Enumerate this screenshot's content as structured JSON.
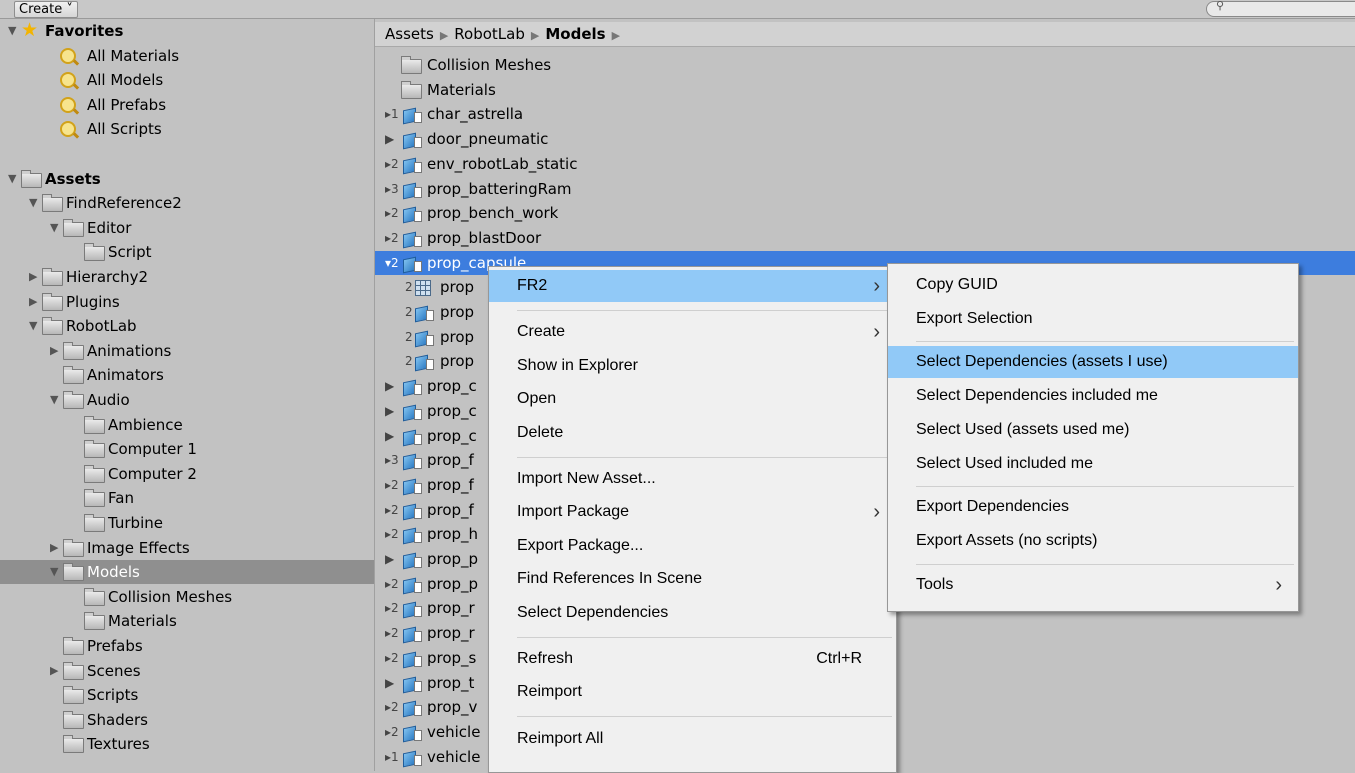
{
  "toolbar": {
    "create_label": "Create ˅",
    "search_placeholder": ""
  },
  "tree": [
    {
      "label": "Favorites",
      "indent": 0,
      "icon": "star",
      "tri": "▼",
      "bold": true
    },
    {
      "label": "All Materials",
      "indent": 2,
      "icon": "search"
    },
    {
      "label": "All Models",
      "indent": 2,
      "icon": "search"
    },
    {
      "label": "All Prefabs",
      "indent": 2,
      "icon": "search"
    },
    {
      "label": "All Scripts",
      "indent": 2,
      "icon": "search"
    },
    {
      "label": "",
      "indent": 0,
      "icon": "none"
    },
    {
      "label": "Assets",
      "indent": 0,
      "icon": "folder",
      "tri": "▼",
      "bold": true
    },
    {
      "label": "FindReference2",
      "indent": 1,
      "icon": "folder",
      "tri": "▼"
    },
    {
      "label": "Editor",
      "indent": 2,
      "icon": "folder",
      "tri": "▼"
    },
    {
      "label": "Script",
      "indent": 3,
      "icon": "folder"
    },
    {
      "label": "Hierarchy2",
      "indent": 1,
      "icon": "folder",
      "tri": "▶"
    },
    {
      "label": "Plugins",
      "indent": 1,
      "icon": "folder",
      "tri": "▶"
    },
    {
      "label": "RobotLab",
      "indent": 1,
      "icon": "folder",
      "tri": "▼"
    },
    {
      "label": "Animations",
      "indent": 2,
      "icon": "folder",
      "tri": "▶"
    },
    {
      "label": "Animators",
      "indent": 2,
      "icon": "folder"
    },
    {
      "label": "Audio",
      "indent": 2,
      "icon": "folder",
      "tri": "▼"
    },
    {
      "label": "Ambience",
      "indent": 3,
      "icon": "folder"
    },
    {
      "label": "Computer 1",
      "indent": 3,
      "icon": "folder"
    },
    {
      "label": "Computer 2",
      "indent": 3,
      "icon": "folder"
    },
    {
      "label": "Fan",
      "indent": 3,
      "icon": "folder"
    },
    {
      "label": "Turbine",
      "indent": 3,
      "icon": "folder"
    },
    {
      "label": "Image Effects",
      "indent": 2,
      "icon": "folder",
      "tri": "▶"
    },
    {
      "label": "Models",
      "indent": 2,
      "icon": "folder",
      "tri": "▼",
      "selected": true
    },
    {
      "label": "Collision Meshes",
      "indent": 3,
      "icon": "folder"
    },
    {
      "label": "Materials",
      "indent": 3,
      "icon": "folder"
    },
    {
      "label": "Prefabs",
      "indent": 2,
      "icon": "folder"
    },
    {
      "label": "Scenes",
      "indent": 2,
      "icon": "folder",
      "tri": "▶"
    },
    {
      "label": "Scripts",
      "indent": 2,
      "icon": "folder"
    },
    {
      "label": "Shaders",
      "indent": 2,
      "icon": "folder"
    },
    {
      "label": "Textures",
      "indent": 2,
      "icon": "folder"
    }
  ],
  "breadcrumb": [
    {
      "label": "Assets",
      "bold": false
    },
    {
      "label": "RobotLab",
      "bold": false
    },
    {
      "label": "Models",
      "bold": true
    }
  ],
  "assets": [
    {
      "label": "Collision Meshes",
      "icon": "folder"
    },
    {
      "label": "Materials",
      "icon": "folder"
    },
    {
      "label": "char_astrella",
      "icon": "model",
      "count": "▸1"
    },
    {
      "label": "door_pneumatic",
      "icon": "model",
      "count": "▶"
    },
    {
      "label": "env_robotLab_static",
      "icon": "model",
      "count": "▸2"
    },
    {
      "label": "prop_batteringRam",
      "icon": "model",
      "count": "▸3"
    },
    {
      "label": "prop_bench_work",
      "icon": "model",
      "count": "▸2"
    },
    {
      "label": "prop_blastDoor",
      "icon": "model",
      "count": "▸2"
    },
    {
      "label": "prop_capsule",
      "icon": "model",
      "count": "▾2",
      "selected": true
    },
    {
      "label": "prop",
      "icon": "grid",
      "count": "2",
      "sub": true
    },
    {
      "label": "prop",
      "icon": "model",
      "count": "2",
      "sub": true
    },
    {
      "label": "prop",
      "icon": "model",
      "count": "2",
      "sub": true
    },
    {
      "label": "prop",
      "icon": "model",
      "count": "2",
      "sub": true
    },
    {
      "label": "prop_c",
      "icon": "model",
      "count": "▶"
    },
    {
      "label": "prop_c",
      "icon": "model",
      "count": "▶"
    },
    {
      "label": "prop_c",
      "icon": "model",
      "count": "▶"
    },
    {
      "label": "prop_f",
      "icon": "model",
      "count": "▸3"
    },
    {
      "label": "prop_f",
      "icon": "model",
      "count": "▸2"
    },
    {
      "label": "prop_f",
      "icon": "model",
      "count": "▸2"
    },
    {
      "label": "prop_h",
      "icon": "model",
      "count": "▸2"
    },
    {
      "label": "prop_p",
      "icon": "model",
      "count": "▶"
    },
    {
      "label": "prop_p",
      "icon": "model",
      "count": "▸2"
    },
    {
      "label": "prop_r",
      "icon": "model",
      "count": "▸2"
    },
    {
      "label": "prop_r",
      "icon": "model",
      "count": "▸2"
    },
    {
      "label": "prop_s",
      "icon": "model",
      "count": "▸2"
    },
    {
      "label": "prop_t",
      "icon": "model",
      "count": "▶"
    },
    {
      "label": "prop_v",
      "icon": "model",
      "count": "▸2"
    },
    {
      "label": "vehicle",
      "icon": "model",
      "count": "▸2"
    },
    {
      "label": "vehicle",
      "icon": "model",
      "count": "▸1"
    }
  ],
  "context_menu": {
    "items": [
      {
        "label": "FR2",
        "arrow": true,
        "highlight": true
      },
      {
        "sep": true
      },
      {
        "label": "Create",
        "arrow": true
      },
      {
        "label": "Show in Explorer"
      },
      {
        "label": "Open"
      },
      {
        "label": "Delete"
      },
      {
        "sep": true
      },
      {
        "label": "Import New Asset..."
      },
      {
        "label": "Import Package",
        "arrow": true
      },
      {
        "label": "Export Package..."
      },
      {
        "label": "Find References In Scene"
      },
      {
        "label": "Select Dependencies"
      },
      {
        "sep": true
      },
      {
        "label": "Refresh",
        "shortcut": "Ctrl+R"
      },
      {
        "label": "Reimport"
      },
      {
        "sep": true
      },
      {
        "label": "Reimport All"
      }
    ]
  },
  "submenu": {
    "items": [
      {
        "label": "Copy GUID"
      },
      {
        "label": "Export Selection"
      },
      {
        "sep": true
      },
      {
        "label": "Select Dependencies (assets I use)",
        "highlight": true
      },
      {
        "label": "Select Dependencies included me"
      },
      {
        "label": "Select Used (assets used me)"
      },
      {
        "label": "Select Used included me"
      },
      {
        "sep": true
      },
      {
        "label": "Export Dependencies"
      },
      {
        "label": "Export Assets (no scripts)"
      },
      {
        "sep": true
      },
      {
        "label": "Tools",
        "arrow": true
      }
    ]
  },
  "colors": {
    "selection_blue": "#3d7dde",
    "menu_highlight": "#91c9f7",
    "panel_bg": "#c2c2c2"
  },
  "icons": {
    "submenu_arrow": "›"
  }
}
